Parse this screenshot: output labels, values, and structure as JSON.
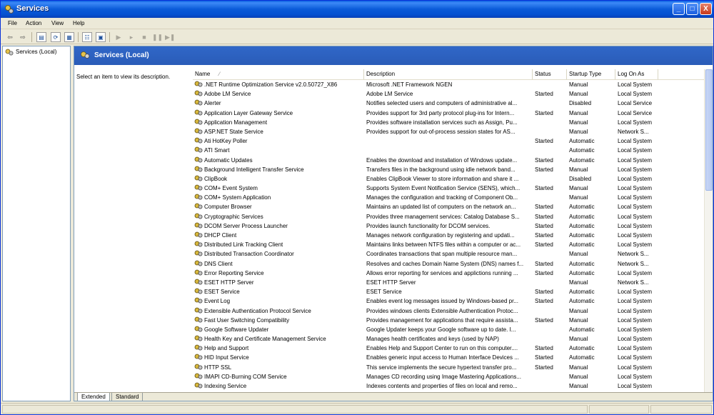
{
  "window": {
    "title": "Services",
    "minimize": "_",
    "maximize": "□",
    "close": "X"
  },
  "menu": [
    "File",
    "Action",
    "View",
    "Help"
  ],
  "toolbar": {
    "back": "⇦",
    "forward": "⇨",
    "start": "▶",
    "play": "▸",
    "stop": "■",
    "pause": "❚❚",
    "restart": "▶❚"
  },
  "tree": {
    "root": "Services (Local)"
  },
  "pane": {
    "title": "Services (Local)",
    "description": "Select an item to view its description."
  },
  "columns": {
    "name": "Name",
    "sort_arrow": "∕",
    "description": "Description",
    "status": "Status",
    "startup": "Startup Type",
    "logon": "Log On As"
  },
  "services": [
    {
      "name": ".NET Runtime Optimization Service v2.0.50727_X86",
      "description": "Microsoft .NET Framework NGEN",
      "status": "",
      "startup": "Manual",
      "logon": "Local System"
    },
    {
      "name": "Adobe LM Service",
      "description": "Adobe LM Service",
      "status": "Started",
      "startup": "Manual",
      "logon": "Local System"
    },
    {
      "name": "Alerter",
      "description": "Notifies selected users and computers of administrative al...",
      "status": "",
      "startup": "Disabled",
      "logon": "Local Service"
    },
    {
      "name": "Application Layer Gateway Service",
      "description": "Provides support for 3rd party protocol plug-ins for Intern...",
      "status": "Started",
      "startup": "Manual",
      "logon": "Local Service"
    },
    {
      "name": "Application Management",
      "description": "Provides software installation services such as Assign, Pu...",
      "status": "",
      "startup": "Manual",
      "logon": "Local System"
    },
    {
      "name": "ASP.NET State Service",
      "description": "Provides support for out-of-process session states for AS...",
      "status": "",
      "startup": "Manual",
      "logon": "Network S..."
    },
    {
      "name": "Ati HotKey Poller",
      "description": "",
      "status": "Started",
      "startup": "Automatic",
      "logon": "Local System"
    },
    {
      "name": "ATI Smart",
      "description": "",
      "status": "",
      "startup": "Automatic",
      "logon": "Local System"
    },
    {
      "name": "Automatic Updates",
      "description": "Enables the download and installation of Windows update...",
      "status": "Started",
      "startup": "Automatic",
      "logon": "Local System"
    },
    {
      "name": "Background Intelligent Transfer Service",
      "description": "Transfers files in the background using idle network band...",
      "status": "Started",
      "startup": "Manual",
      "logon": "Local System"
    },
    {
      "name": "ClipBook",
      "description": "Enables ClipBook Viewer to store information and share it ...",
      "status": "",
      "startup": "Disabled",
      "logon": "Local System"
    },
    {
      "name": "COM+ Event System",
      "description": "Supports System Event Notification Service (SENS), which...",
      "status": "Started",
      "startup": "Manual",
      "logon": "Local System"
    },
    {
      "name": "COM+ System Application",
      "description": "Manages the configuration and tracking of Component Ob...",
      "status": "",
      "startup": "Manual",
      "logon": "Local System"
    },
    {
      "name": "Computer Browser",
      "description": "Maintains an updated list of computers on the network an...",
      "status": "Started",
      "startup": "Automatic",
      "logon": "Local System"
    },
    {
      "name": "Cryptographic Services",
      "description": "Provides three management services: Catalog Database S...",
      "status": "Started",
      "startup": "Automatic",
      "logon": "Local System"
    },
    {
      "name": "DCOM Server Process Launcher",
      "description": "Provides launch functionality for DCOM services.",
      "status": "Started",
      "startup": "Automatic",
      "logon": "Local System"
    },
    {
      "name": "DHCP Client",
      "description": "Manages network configuration by registering and updati...",
      "status": "Started",
      "startup": "Automatic",
      "logon": "Local System"
    },
    {
      "name": "Distributed Link Tracking Client",
      "description": "Maintains links between NTFS files within a computer or ac...",
      "status": "Started",
      "startup": "Automatic",
      "logon": "Local System"
    },
    {
      "name": "Distributed Transaction Coordinator",
      "description": "Coordinates transactions that span multiple resource man...",
      "status": "",
      "startup": "Manual",
      "logon": "Network S..."
    },
    {
      "name": "DNS Client",
      "description": "Resolves and caches Domain Name System (DNS) names f...",
      "status": "Started",
      "startup": "Automatic",
      "logon": "Network S..."
    },
    {
      "name": "Error Reporting Service",
      "description": "Allows error reporting for services and applictions running ...",
      "status": "Started",
      "startup": "Automatic",
      "logon": "Local System"
    },
    {
      "name": "ESET HTTP Server",
      "description": "ESET HTTP Server",
      "status": "",
      "startup": "Manual",
      "logon": "Network S..."
    },
    {
      "name": "ESET Service",
      "description": "ESET Service",
      "status": "Started",
      "startup": "Automatic",
      "logon": "Local System"
    },
    {
      "name": "Event Log",
      "description": "Enables event log messages issued by Windows-based pr...",
      "status": "Started",
      "startup": "Automatic",
      "logon": "Local System"
    },
    {
      "name": "Extensible Authentication Protocol Service",
      "description": "Provides windows clients Extensible Authentication Protoc...",
      "status": "",
      "startup": "Manual",
      "logon": "Local System"
    },
    {
      "name": "Fast User Switching Compatibility",
      "description": "Provides management for applications that require assista...",
      "status": "Started",
      "startup": "Manual",
      "logon": "Local System"
    },
    {
      "name": "Google Software Updater",
      "description": "Google Updater keeps your Google software up to date. I...",
      "status": "",
      "startup": "Automatic",
      "logon": "Local System"
    },
    {
      "name": "Health Key and Certificate Management Service",
      "description": "Manages health certificates and keys (used by NAP)",
      "status": "",
      "startup": "Manual",
      "logon": "Local System"
    },
    {
      "name": "Help and Support",
      "description": "Enables Help and Support Center to run on this computer....",
      "status": "Started",
      "startup": "Automatic",
      "logon": "Local System"
    },
    {
      "name": "HID Input Service",
      "description": "Enables generic input access to Human Interface Devices ...",
      "status": "Started",
      "startup": "Automatic",
      "logon": "Local System"
    },
    {
      "name": "HTTP SSL",
      "description": "This service implements the secure hypertext transfer pro...",
      "status": "Started",
      "startup": "Manual",
      "logon": "Local System"
    },
    {
      "name": "IMAPI CD-Burning COM Service",
      "description": "Manages CD recording using Image Mastering Applications...",
      "status": "",
      "startup": "Manual",
      "logon": "Local System"
    },
    {
      "name": "Indexing Service",
      "description": "Indexes contents and properties of files on local and remo...",
      "status": "",
      "startup": "Manual",
      "logon": "Local System"
    }
  ],
  "tabs": [
    "Extended",
    "Standard"
  ]
}
